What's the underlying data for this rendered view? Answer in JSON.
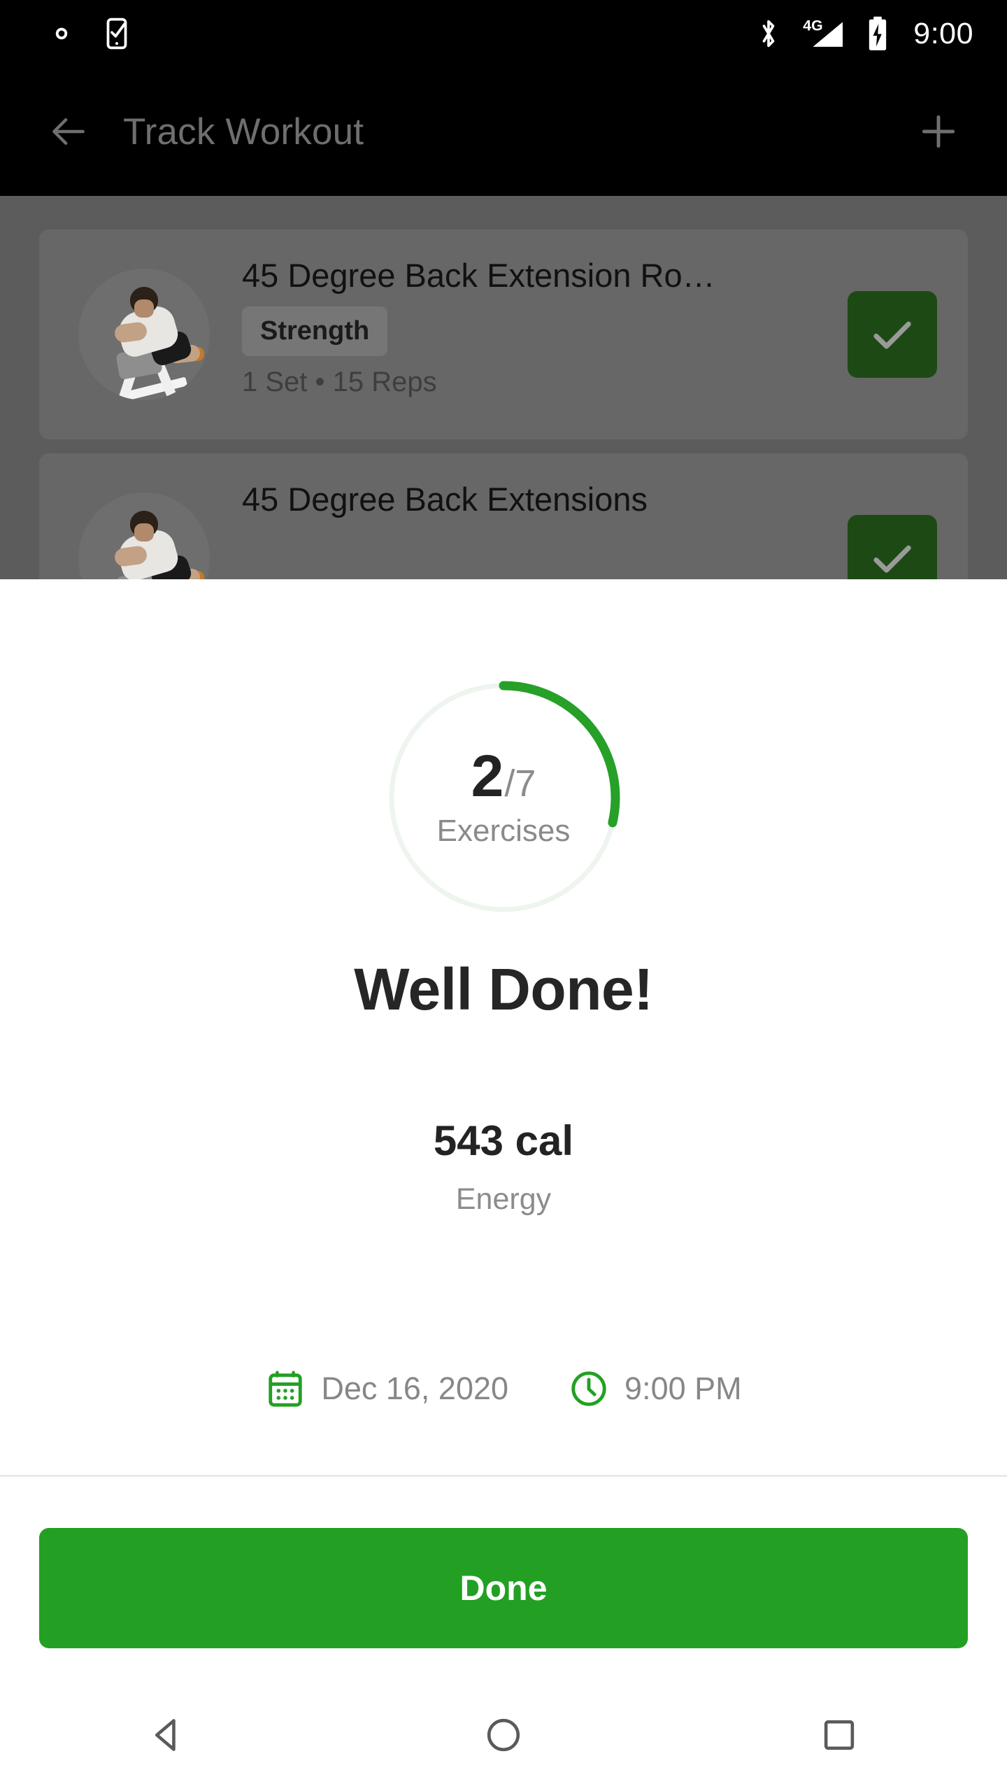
{
  "status_bar": {
    "time": "9:00",
    "icons_left": [
      "gear-icon",
      "phone-check-icon"
    ],
    "icons_right": [
      "bluetooth-icon",
      "signal-4g-icon",
      "battery-charging-icon"
    ],
    "network_label": "4G"
  },
  "app_bar": {
    "title": "Track Workout",
    "back_icon": "arrow-left-icon",
    "add_icon": "plus-icon"
  },
  "background": {
    "exercises": [
      {
        "name": "45 Degree Back Extension Ro…",
        "tag": "Strength",
        "meta": "1 Set • 15 Reps",
        "completed": true,
        "thumbnail": "back-extension-figure"
      },
      {
        "name": "45 Degree Back Extensions",
        "tag": "",
        "meta": "",
        "completed": true,
        "thumbnail": "back-extension-figure"
      }
    ]
  },
  "sheet": {
    "progress": {
      "completed": "2",
      "total": "/7",
      "label": "Exercises",
      "percent": 28.6,
      "arc_color": "#27a028",
      "track_color": "#eef4ee"
    },
    "heading": "Well Done!",
    "energy": {
      "value": "543 cal",
      "label": "Energy"
    },
    "meta": {
      "date": "Dec 16, 2020",
      "date_icon": "calendar-icon",
      "time": "9:00 PM",
      "time_icon": "clock-icon",
      "icon_color": "#23a023"
    },
    "primary_button": {
      "label": "Done",
      "color": "#23a023"
    }
  },
  "nav_bar": {
    "back": "triangle-back-icon",
    "home": "circle-home-icon",
    "recents": "square-recents-icon"
  }
}
